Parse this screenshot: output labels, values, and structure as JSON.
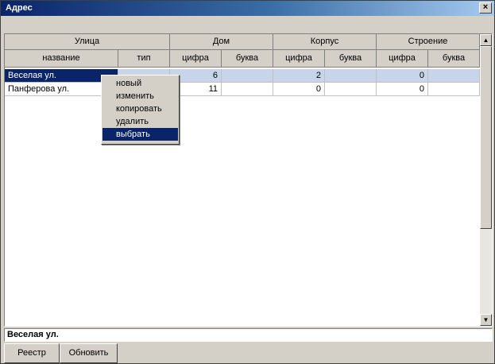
{
  "window": {
    "title": "Адрес",
    "close_glyph": "×"
  },
  "grid": {
    "group_headers": [
      "Улица",
      "Дом",
      "Корпус",
      "Строение"
    ],
    "column_headers": [
      "название",
      "тип",
      "цифра",
      "буква",
      "цифра",
      "буква",
      "цифра",
      "буква"
    ],
    "rows": [
      [
        "Веселая ул.",
        "",
        "6",
        "",
        "2",
        "",
        "0",
        ""
      ],
      [
        "Панферова ул.",
        "",
        "11",
        "",
        "0",
        "",
        "0",
        ""
      ]
    ],
    "selected_row": 0
  },
  "context_menu": {
    "items": [
      "новый",
      "изменить",
      "копировать",
      "удалить",
      "выбрать"
    ],
    "active_item": 4
  },
  "status": {
    "text": "Веселая ул."
  },
  "buttons": {
    "registry": "Реестр",
    "refresh": "Обновить"
  },
  "scrollbar": {
    "up_glyph": "▲",
    "down_glyph": "▼"
  }
}
